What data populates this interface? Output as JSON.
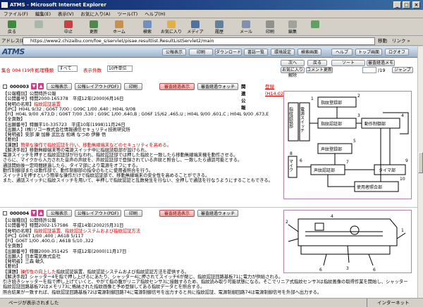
{
  "window": {
    "title": "ATMS - Microsoft Internet Explorer",
    "min": "_",
    "max": "□",
    "close": "×"
  },
  "menu": [
    "ファイル(F)",
    "編集(E)",
    "表示(V)",
    "お気に入り(A)",
    "ツール(T)",
    "ヘルプ(H)"
  ],
  "toolbar": [
    "戻る",
    "",
    "中止",
    "更新",
    "ホーム",
    "検索",
    "お気に入り",
    "メディア",
    "履歴",
    "メール",
    "印刷",
    "編集",
    ""
  ],
  "address": {
    "label": "アドレス(D)",
    "url": "https://www2.chizaibu.com/foe_s/servlet/pisae.resultlist.ResultListServlet2/main",
    "go": "移動",
    "links": "リンク »"
  },
  "site": {
    "logo": "ATMS",
    "nav": [
      "公報表示",
      "印刷",
      "ダウンロード",
      "書誌一覧",
      "環境設定",
      "検索画面",
      "ヘルプ",
      "トップ画面",
      "ログオフ"
    ],
    "prev": "次へ",
    "back_label": "戻る",
    "sort": "ソート",
    "review_memo": "審査経過メモ",
    "result": "集合 004 (19件)",
    "proc_type_label": "処理種類",
    "proc_type": "すべて",
    "disp_label": "表示件数",
    "disp": "10件単位",
    "clear": "お気に入り解除",
    "comment": "コメント更新",
    "page_of": "/19",
    "jump": "ジャンプ"
  },
  "records": [
    {
      "no": "000003",
      "btn_pub": "公報表示",
      "btn_layout": "公報レイアウト(PDF)",
      "btn_print": "印刷",
      "btn_review": "審査経過表示",
      "btn_watch": "審査経過ウォッチ",
      "related": "関連公報",
      "related_link": "登録(H14.02.19)",
      "lines": [
        [
          "【公報種別】",
          "公開特許公報",
          ""
        ],
        [
          "【公開番号】",
          "特開2000-165378",
          "　平成12年(2000)6月16日"
        ],
        [
          "【発明の名称】",
          "指紋認証装置",
          ""
        ],
        [
          "【IPC】",
          "H04L 9/32 ; G06T 7/00 ; G09C 1/00 ,640 ; H04L 9/08",
          ""
        ],
        [
          "【FI】",
          "H04L 9/00 ,673,D ; G06T 7/00 ,530 ; G09C 1/00 ,640,B ; G06F 15/62 ,465,U ; H04L 9/00 ,601,C ; H04L 9/00 ,673,E",
          ""
        ],
        [
          "【全頁数】",
          "",
          ""
        ],
        [
          "【出願番号】",
          "特願平10-335723",
          "　平成10年(1998)11月26日"
        ],
        [
          "【出願人】",
          "(株)リコー",
          "株式会社情報通信セキュリティ技術研究所"
        ],
        [
          "【発明者】",
          "",
          "安部 康 加藤 武比古 松嶋 なつめ 伊藤 悟"
        ],
        [
          "【要約】",
          "",
          ""
        ],
        [
          "【課題】",
          "簡単な操作で指紋認証を行い、移動無線端末などのセキュリティを高める。",
          ""
        ],
        [
          "【解決手段】",
          "移動無線端末等の電源スイッチ中に指紋読取部が設けられ、",
          ""
        ],
        [
          "",
          "電源スイッチを押すと指紋認証部が行なわれ、指紋認証部では押した指紋と一致したら移動無線端末機を動作させる。",
          ""
        ],
        [
          "",
          "さらに、マイクから入力された音声の声紋を、声紋認証部で登録されている声紋と照合し、一致したら通話可能とする。",
          ""
        ],
        [
          "",
          "通話開始後一定時間経過したら、タイマ部により電源をオフにする。",
          ""
        ],
        [
          "",
          "動作制御部または動作部で、動作制御部の指令のもとに使用者照合を行う。",
          ""
        ],
        [
          "",
          "スイッチ1を押すという簡単な操作だけで指紋認証部で、移動無線端末の安全性を高めることができる。",
          ""
        ],
        [
          "",
          "また、通話スイッチに指紋スイッチを用いて、半押しで指紋認証と乱数発生を行ない、全押しで通話を行なうようにすることもできる。",
          ""
        ]
      ],
      "fig": {
        "labels": [
          "指紋読取部",
          "電源スイッチ",
          "指紋登録部",
          "指紋認証部",
          "動作制御部",
          "声紋登録部",
          "声紋認証部",
          "マイク",
          "使用者照合部",
          "タイマ部"
        ],
        "nums": [
          "1",
          "2",
          "3",
          "4",
          "5",
          "6",
          "7",
          "8",
          "9",
          "10"
        ]
      }
    },
    {
      "no": "000004",
      "btn_pub": "公報表示",
      "btn_layout": "公報レイアウト(PDF)",
      "btn_print": "印刷",
      "btn_review": "審査経過表示",
      "btn_watch": "審査経過ウォッチ",
      "lines": [
        [
          "【公報種別】",
          "公開特許公報",
          ""
        ],
        [
          "【公開番号】",
          "特開2002-157586",
          "　平成14年(2002)5月31日"
        ],
        [
          "【発明の名称】",
          "指紋認証装置",
          "、指紋認証システムおよび指紋認証方法"
        ],
        [
          "【IPC】",
          "G06T 1/00 ,400 ; A61B 5/117",
          ""
        ],
        [
          "【FI】",
          "G06T 1/00 ,400,G ; A61B 5/10 ,322",
          ""
        ],
        [
          "【全頁数】",
          "",
          ""
        ],
        [
          "【出願番号】",
          "特願2000-351425",
          "　平成12年(2000)11月17日"
        ],
        [
          "【出願人】",
          "日本電気株式会社",
          ""
        ],
        [
          "【発明者】",
          "",
          "三森 敏久"
        ],
        [
          "【要約】",
          "",
          ""
        ],
        [
          "【課題】",
          "操作性の向上した",
          "指紋認証装置、指紋認証システムおよび指紋認証方法を提供する。"
        ],
        [
          "【解決手段】",
          "シャッター4を指で押し上げるにあたり、シャッター4に押されてスイッチ6が閉じ、指紋認証回路基板71に電力が供給される。",
          ""
        ],
        [
          "",
          "引き続きシャッターを指で押し上げていくと、やがて指の腹がリニア指紋センサ3に接触するため、指紋読み取り可能状態になる。そこでリニア式指紋センサ3は指紋画像の取得作業を開始し、シャッター",
          ""
        ],
        [
          "",
          "指紋認証回路基板72はメモリ73に格納された指紋画像と予め登録してある指紋データとを照合する。",
          ""
        ],
        [
          "",
          "照合結果が一致すれば、指紋認証回路基板72は電源制御回路74に電源制御信号を出力すると共に指紋認証、電源制御回路74は電源制御信号を外部へ出力する。",
          ""
        ]
      ],
      "fig": {
        "nums": [
          "4",
          "2",
          "1",
          "6",
          "6",
          "3"
        ]
      }
    }
  ],
  "status": {
    "text": "ページが表示されました",
    "zone": "インターネット"
  }
}
